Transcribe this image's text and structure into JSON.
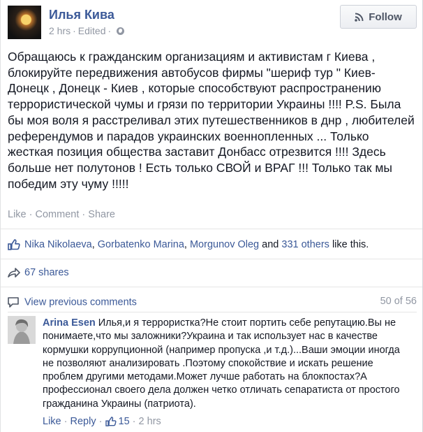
{
  "post": {
    "author": "Илья Кива",
    "time": "2 hrs",
    "edited": "Edited",
    "separator": "·",
    "follow_label": "Follow",
    "text": "Обращаюсь к гражданским организациям и активистам г Киева , блокируйте передвижения автобусов фирмы \"шериф тур \" Киев-Донецк , Донецк - Киев , которые способствуют распространению террористической чумы и грязи по территории Украины !!!! P.S. Была бы моя воля я расстреливал этих путешественников в днр , любителей референдумов и парадов украинских военнопленных ... Только жесткая позиция общества заставит Донбасс отрезвится !!!! Здесь больше нет полутонов ! Есть только СВОЙ и ВРАГ !!! Только так мы победим эту чуму !!!!!",
    "actions": {
      "like": "Like",
      "comment": "Comment",
      "share": "Share"
    }
  },
  "likes": {
    "name1": "Nika Nikolaeva",
    "name2": "Gorbatenko Marina",
    "name3": "Morgunov Oleg",
    "and_text": "and",
    "others": "331 others",
    "suffix": "like this.",
    "comma": ","
  },
  "shares": {
    "label": "67 shares"
  },
  "comments": {
    "view_previous": "View previous comments",
    "count": "50 of 56",
    "items": [
      {
        "author": "Arina Esen",
        "text": "Илья,и я террористка?Не стоит портить себе репутацию.Вы не понимаете,что мы заложники?Украина и так использует нас в качестве кормушки коррупционной (например пропуска ,и т.д.)...Ваши эмоции иногда не позволяют анализировать .Поэтому спокойствие и искать решение проблем другими методами.Может лучше работать на блокпостах?А профессионал своего дела должен четко отличать сепаратиста от простого гражданина Украины (патриота).",
        "like": "Like",
        "reply": "Reply",
        "likes_count": "15",
        "time": "2 hrs"
      }
    ]
  },
  "colors": {
    "link": "#3b5998",
    "muted": "#9197a3",
    "text": "#141823"
  }
}
